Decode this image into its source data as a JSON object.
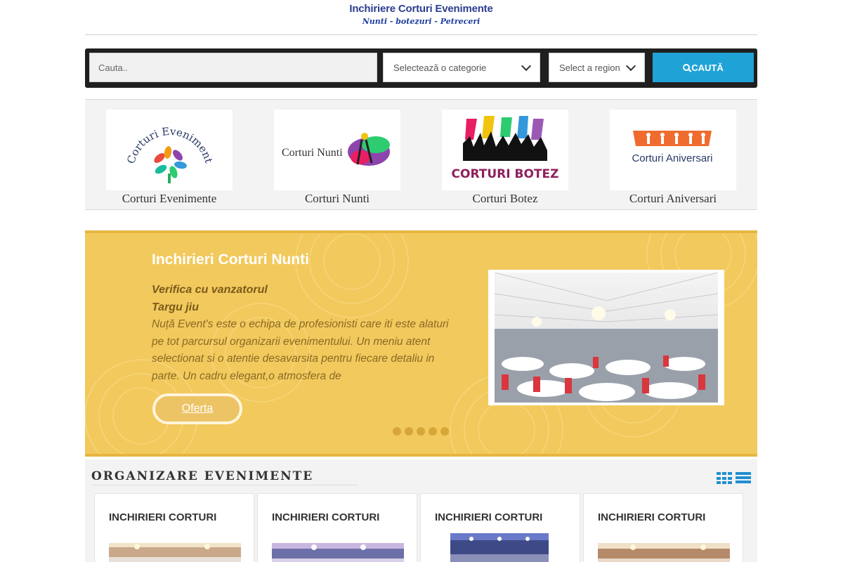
{
  "header": {
    "title": "Inchiriere Corturi Evenimente",
    "subtitle": "Nunti - botezuri - Petreceri"
  },
  "search": {
    "placeholder": "Cauta..",
    "category_label": "Selectează o categorie",
    "region_label": "Select a region",
    "button_label": "CAUTĂ",
    "button_color": "#1fa3d6"
  },
  "categories": [
    {
      "label": "Corturi Evenimente",
      "logo_text": "Corturi Evenimente",
      "icon": "hands-logo-icon"
    },
    {
      "label": "Corturi Nunti",
      "logo_text": "Corturi Nunti",
      "icon": "dancers-logo-icon"
    },
    {
      "label": "Corturi Botez",
      "logo_text": "CORTURI BOTEZ",
      "icon": "crowd-logo-icon"
    },
    {
      "label": "Corturi Aniversari",
      "logo_text": "Corturi Aniversari",
      "icon": "people-logo-icon"
    }
  ],
  "slider": {
    "title": "Inchirieri Corturi Nunti",
    "seller_label": "Verifica cu vanzatorul",
    "location": "Targu jiu",
    "description": "Nuță Event's este o echipa de profesionisti care iti este alaturi pe tot parcursul organizarii evenimentului. Un meniu atent selectionat si o atentie desavarsita pentru fiecare detaliu in parte. Un cadru elegant,o atmosfera de",
    "button_label": "Oferta",
    "dots_count": 5,
    "background_color": "#f2c95d"
  },
  "section": {
    "title": "ORGANIZARE EVENIMENTE",
    "view_icons": [
      "grid-view-icon",
      "list-view-icon"
    ],
    "cards": [
      {
        "title": "INCHIRIERI CORTURI"
      },
      {
        "title": "INCHIRIERI CORTURI"
      },
      {
        "title": "INCHIRIERI CORTURI"
      },
      {
        "title": "INCHIRIERI CORTURI"
      }
    ]
  }
}
